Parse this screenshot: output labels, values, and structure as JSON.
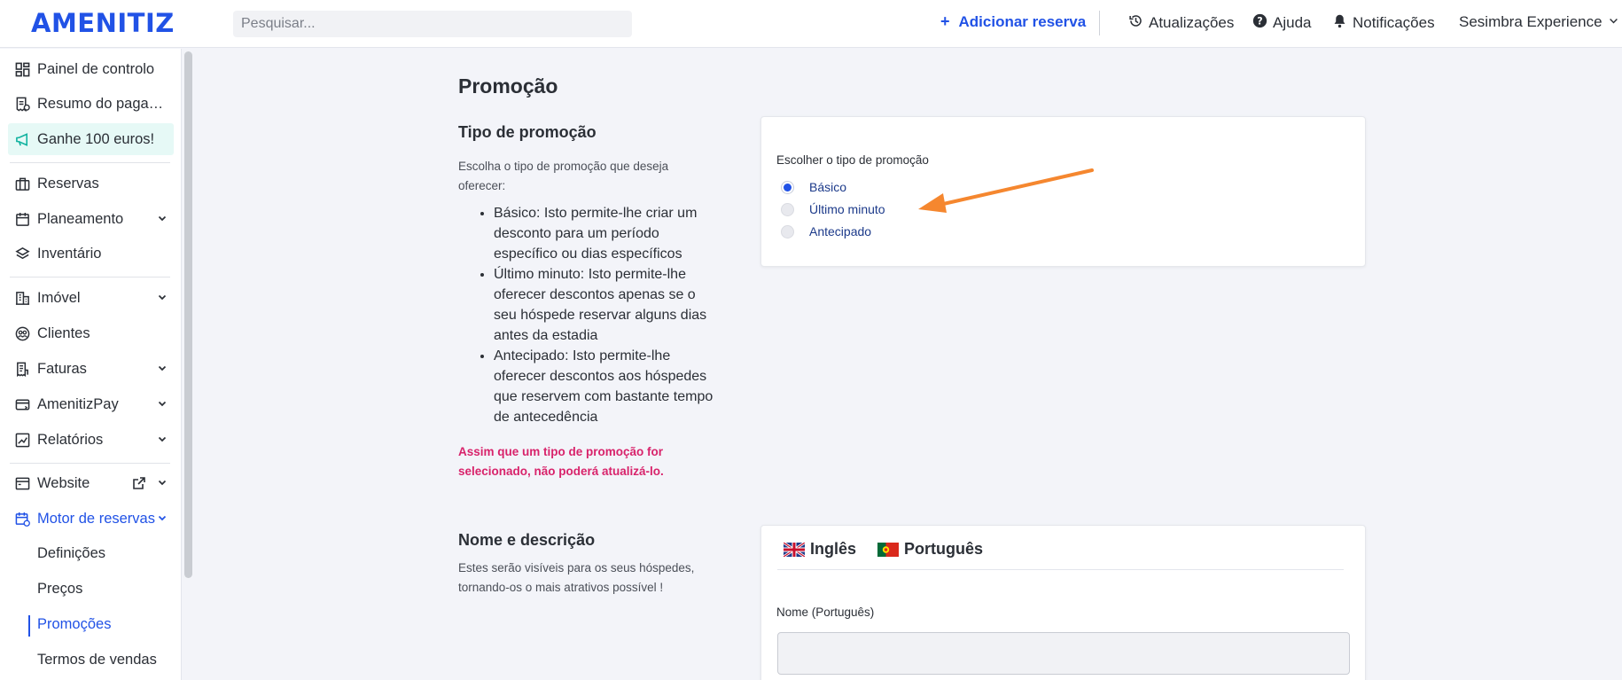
{
  "header": {
    "logo": "AMENITIZ",
    "search_placeholder": "Pesquisar...",
    "add_booking": "Adicionar reserva",
    "updates": "Atualizações",
    "help": "Ajuda",
    "notifications": "Notificações",
    "account": "Sesimbra Experience"
  },
  "sidebar": {
    "dashboard": "Painel de controlo",
    "payments": "Resumo do pagamento",
    "promo": "Ganhe 100 euros!",
    "bookings": "Reservas",
    "planning": "Planeamento",
    "inventory": "Inventário",
    "property": "Imóvel",
    "clients": "Clientes",
    "invoices": "Faturas",
    "amenitizpay": "AmenitizPay",
    "reports": "Relatórios",
    "website": "Website",
    "booking_engine": "Motor de reservas",
    "sub": {
      "settings": "Definições",
      "prices": "Preços",
      "promotions": "Promoções",
      "terms": "Termos de vendas"
    }
  },
  "main": {
    "page_title": "Promoção",
    "type_section": {
      "title": "Tipo de promoção",
      "description": "Escolha o tipo de promoção que deseja oferecer:",
      "bullets": [
        "Básico: Isto permite-lhe criar um desconto para um período específico ou dias específicos",
        "Último minuto: Isto permite-lhe oferecer descontos apenas se o seu hóspede reservar alguns dias antes da estadia",
        "Antecipado: Isto permite-lhe oferecer descontos aos hóspedes que reservem com bastante tempo de antecedência"
      ],
      "warning": "Assim que um tipo de promoção for selecionado, não poderá atualizá-lo.",
      "radio_title": "Escolher o tipo de promoção",
      "options": [
        "Básico",
        "Último minuto",
        "Antecipado"
      ],
      "selected": "Básico"
    },
    "name_section": {
      "title": "Nome e descrição",
      "description": "Estes serão visíveis para os seus hóspedes, tornando-os o mais atrativos possível !",
      "tabs": [
        "Inglês",
        "Português"
      ],
      "field_label": "Nome (Português)",
      "field_value": ""
    }
  },
  "colors": {
    "brand": "#2152e6",
    "warning": "#d8236b",
    "annotation_arrow": "#f5872f",
    "promo_bg": "#e6f9f6"
  }
}
